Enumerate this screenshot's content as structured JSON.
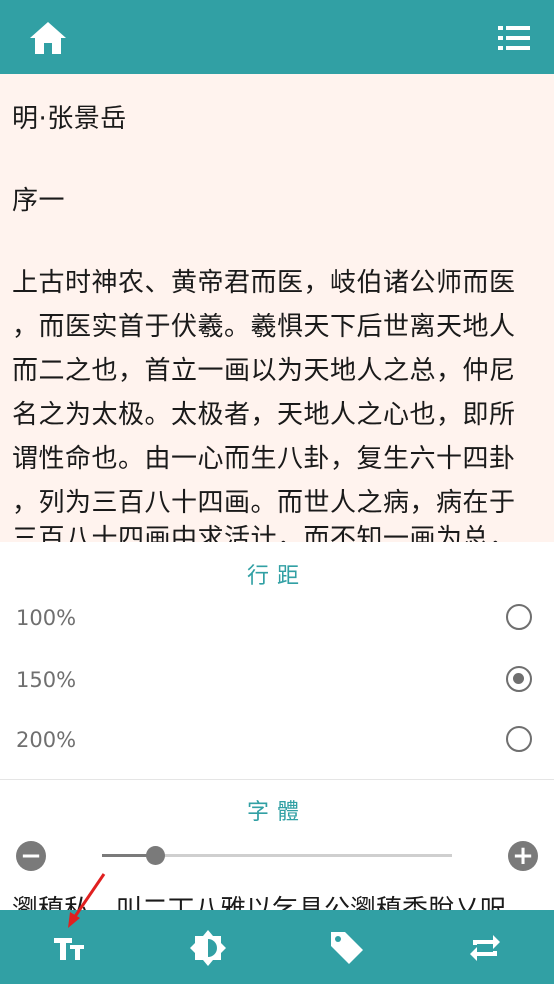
{
  "header": {
    "home_icon": "home-icon",
    "menu_icon": "list-menu-icon",
    "bar_color": "#31a0a4"
  },
  "reader": {
    "background": "#fff3ee",
    "lines": [
      "明·张景岳",
      "序一",
      "上古时神农、黄帝君而医，岐伯诸公师而医",
      "，而医实首于伏羲。羲惧天下后世离天地人",
      "而二之也，首立一画以为天地人之总，仲尼",
      "名之为太极。太极者，天地人之心也，即所",
      "谓性命也。由一心而生八卦，复生六十四卦",
      "，列为三百八十四画。而世人之病，病在于",
      "三百八十四画中求活计，而不知一画为总，"
    ],
    "peek_line": "瀏稹私，叫二丅八雅以乞具公瀏稹秂脫乂呎"
  },
  "line_spacing": {
    "title": "行距",
    "options": [
      {
        "label": "100%",
        "selected": false
      },
      {
        "label": "150%",
        "selected": true
      },
      {
        "label": "200%",
        "selected": false
      }
    ]
  },
  "font_size": {
    "title": "字體",
    "minus_label": "−",
    "plus_label": "+",
    "slider_value": 0.15
  },
  "bottom_bar": {
    "items": [
      {
        "name": "font-size-tab",
        "icon": "text-size-icon"
      },
      {
        "name": "brightness-tab",
        "icon": "brightness-icon"
      },
      {
        "name": "bookmark-tab",
        "icon": "tag-icon"
      },
      {
        "name": "repeat-tab",
        "icon": "repeat-icon"
      }
    ]
  },
  "annotation": {
    "icon": "red-arrow-icon",
    "color": "#e02020"
  }
}
